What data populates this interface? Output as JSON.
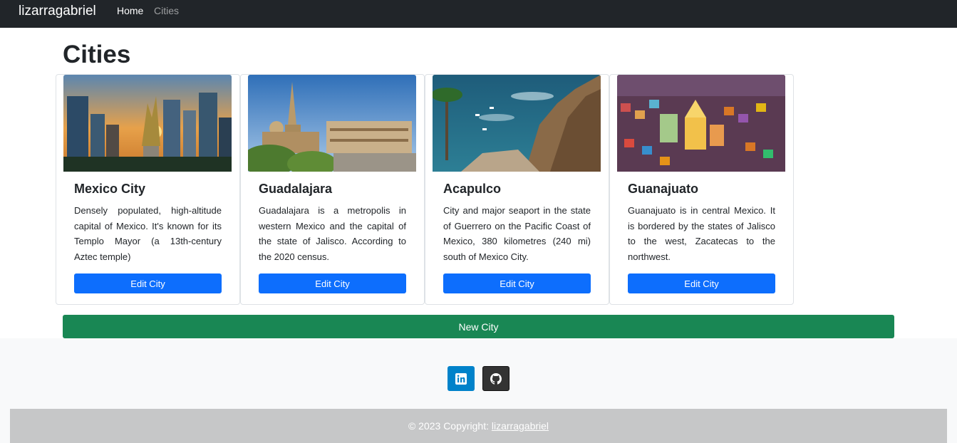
{
  "navbar": {
    "brand": "lizarragabriel",
    "links": [
      "Home",
      "Cities"
    ]
  },
  "page": {
    "title": "Cities"
  },
  "cities": [
    {
      "name": "Mexico City",
      "description": "Densely populated, high-altitude capital of Mexico. It's known for its Templo Mayor (a 13th-century Aztec temple)",
      "button": "Edit City"
    },
    {
      "name": "Guadalajara",
      "description": "Guadalajara is a metropolis in western Mexico and the capital of the state of Jalisco. According to the 2020 census.",
      "button": "Edit City"
    },
    {
      "name": "Acapulco",
      "description": "City and major seaport in the state of Guerrero on the Pacific Coast of Mexico, 380 kilometres (240 mi) south of Mexico City.",
      "button": "Edit City"
    },
    {
      "name": "Guanajuato",
      "description": "Guanajuato is in central Mexico. It is bordered by the states of Jalisco to the west, Zacatecas to the northwest.",
      "button": "Edit City"
    }
  ],
  "new_city_button": "New City",
  "footer": {
    "social": [
      "linkedin-icon",
      "github-icon"
    ],
    "copyright_prefix": "© 2023 Copyright: ",
    "copyright_link": "lizarragabriel"
  },
  "colors": {
    "navbar": "#212529",
    "primary": "#0d6efd",
    "success": "#198754",
    "linkedin": "#0082ca",
    "github": "#333333",
    "footer": "#f8f9fa",
    "copyright_bar": "#c6c7c8"
  }
}
